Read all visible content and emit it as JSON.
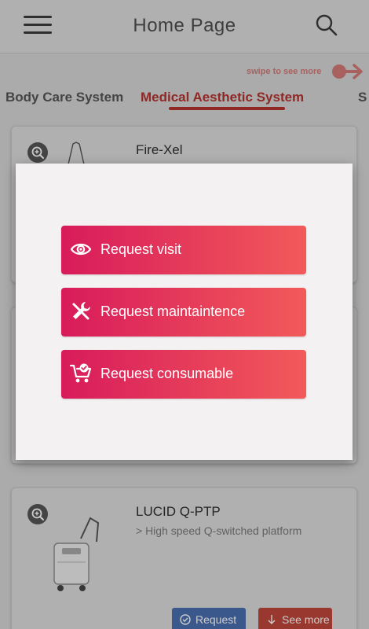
{
  "header": {
    "title": "Home Page",
    "menu_icon": "hamburger-menu-icon",
    "search_icon": "search-icon"
  },
  "swipe_hint": {
    "text": "swipe to see more",
    "icon": "swipe-arrow-icon",
    "color": "#d47a78"
  },
  "tabs": [
    {
      "label": "Body Care System",
      "active": false
    },
    {
      "label": "Medical Aesthetic System",
      "active": true
    },
    {
      "label": "S",
      "active": false
    }
  ],
  "products": [
    {
      "name": "Fire-Xel",
      "subtitle": ""
    },
    {
      "name": "",
      "subtitle": ""
    },
    {
      "name": "LUCID Q-PTP",
      "subtitle": "> High speed Q-switched platform",
      "request_label": "Request",
      "more_label": "See more"
    }
  ],
  "modal": {
    "actions": [
      {
        "label": "Request visit",
        "icon": "eye-icon"
      },
      {
        "label": "Request maintaintence",
        "icon": "tools-icon"
      },
      {
        "label": "Request consumable",
        "icon": "cart-check-icon"
      }
    ]
  },
  "colors": {
    "accent": "#b4322e",
    "gradient_start": "#d81b5b",
    "gradient_end": "#f25a5a",
    "request_button": "#4a6fb0",
    "see_more_button": "#c0463a"
  }
}
